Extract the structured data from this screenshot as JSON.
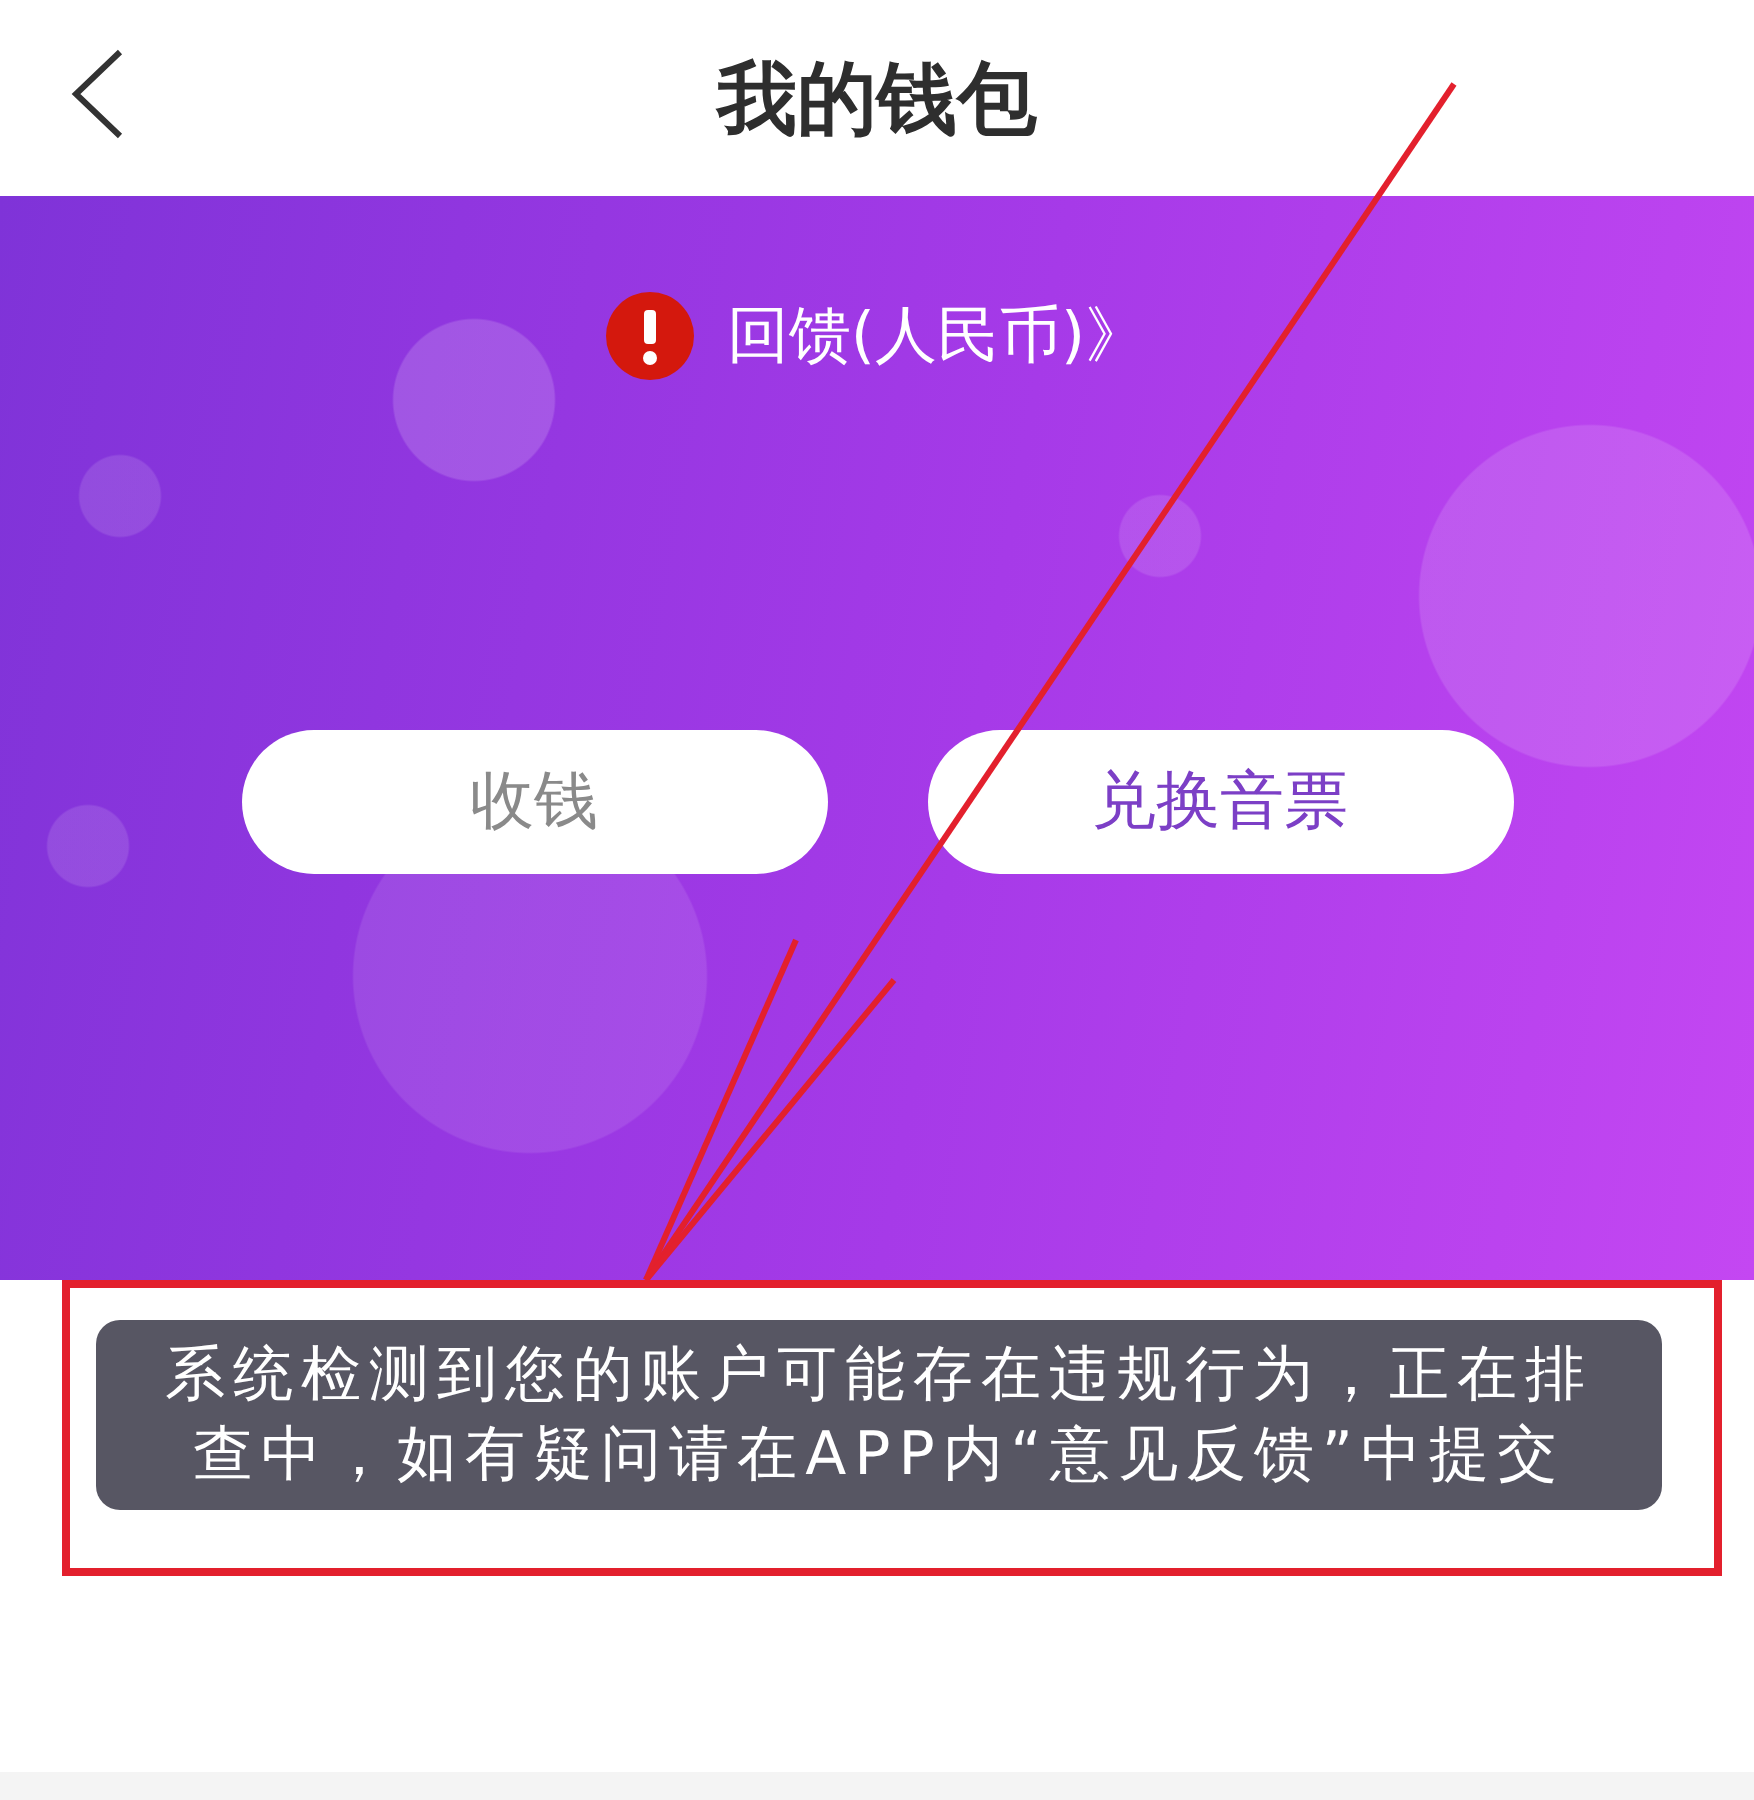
{
  "header": {
    "title": "我的钱包"
  },
  "banner": {
    "alert_link": "回馈(人民币)》"
  },
  "actions": [
    {
      "label": "收钱",
      "kind": "plain"
    },
    {
      "label": "兑换音票",
      "kind": "accent"
    }
  ],
  "toast": {
    "message": "系统检测到您的账户可能存在违规行为，正在排查中，如有疑问请在APP内“意见反馈”中提交"
  }
}
